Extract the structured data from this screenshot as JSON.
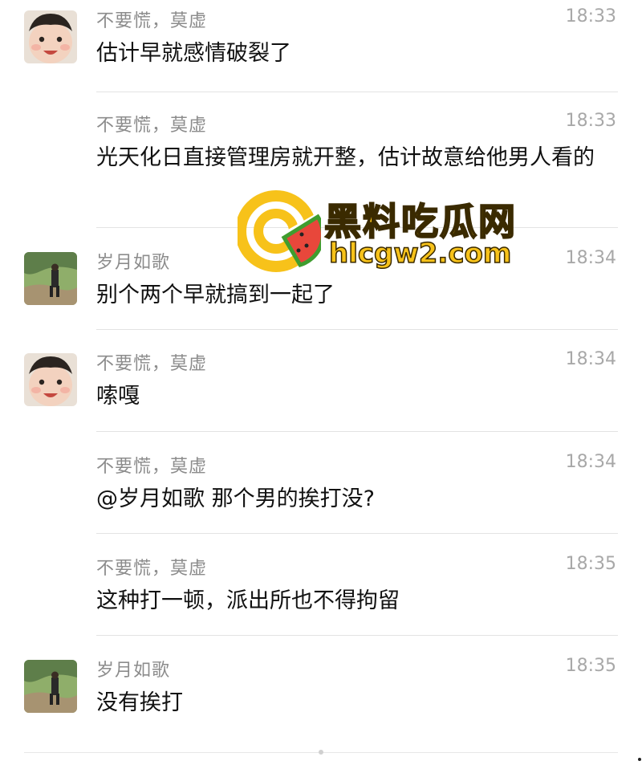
{
  "messages": [
    {
      "sender": "不要慌，莫虚",
      "time": "18:33",
      "text": "估计早就感情破裂了",
      "avatar": "baby-avatar"
    },
    {
      "sender": "不要慌，莫虚",
      "time": "18:33",
      "text": "光天化日直接管理房就开整，估计故意给他男人看的",
      "avatar": null
    },
    {
      "sender": "岁月如歌",
      "time": "18:34",
      "text": "别个两个早就搞到一起了",
      "avatar": "landscape-avatar"
    },
    {
      "sender": "不要慌，莫虚",
      "time": "18:34",
      "text": "嗦嘎",
      "avatar": "baby-avatar"
    },
    {
      "sender": "不要慌，莫虚",
      "time": "18:34",
      "text": "@岁月如歌 那个男的挨打没?",
      "avatar": null
    },
    {
      "sender": "不要慌，莫虚",
      "time": "18:35",
      "text": "这种打一顿，派出所也不得拘留",
      "avatar": null
    },
    {
      "sender": "岁月如歌",
      "time": "18:35",
      "text": "没有挨打",
      "avatar": "landscape-avatar"
    }
  ],
  "watermark": {
    "title": "黑料吃瓜网",
    "url": "hlcgw2.com",
    "colors": {
      "primary": "#f7c21a",
      "watermelon": "#e8473b",
      "rind": "#3f9d2f"
    }
  },
  "colors": {
    "sender": "#8c8c8c",
    "time": "#a8a8a8",
    "text": "#111111",
    "divider": "#e3e3e3"
  }
}
